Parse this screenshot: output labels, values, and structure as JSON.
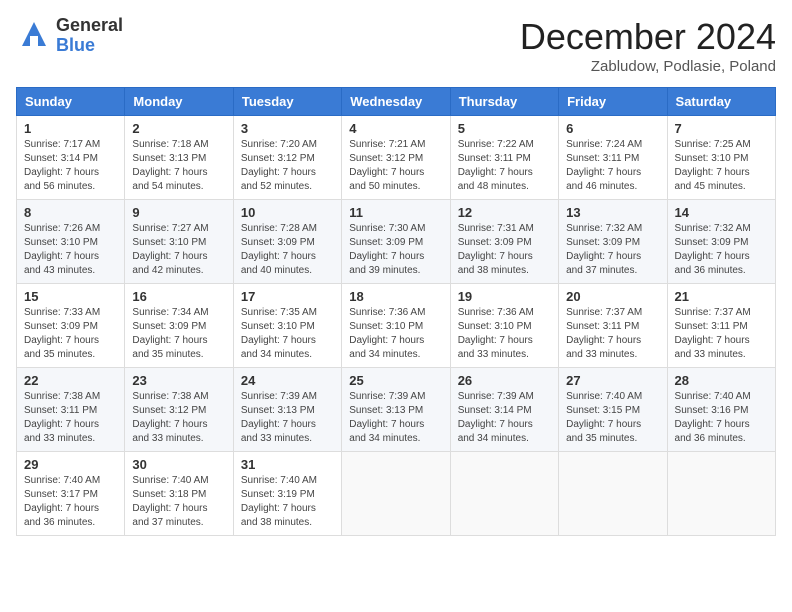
{
  "header": {
    "logo_general": "General",
    "logo_blue": "Blue",
    "month_title": "December 2024",
    "location": "Zabludow, Podlasie, Poland"
  },
  "days_of_week": [
    "Sunday",
    "Monday",
    "Tuesday",
    "Wednesday",
    "Thursday",
    "Friday",
    "Saturday"
  ],
  "weeks": [
    [
      {
        "day": "1",
        "sunrise": "7:17 AM",
        "sunset": "3:14 PM",
        "daylight": "7 hours and 56 minutes."
      },
      {
        "day": "2",
        "sunrise": "7:18 AM",
        "sunset": "3:13 PM",
        "daylight": "7 hours and 54 minutes."
      },
      {
        "day": "3",
        "sunrise": "7:20 AM",
        "sunset": "3:12 PM",
        "daylight": "7 hours and 52 minutes."
      },
      {
        "day": "4",
        "sunrise": "7:21 AM",
        "sunset": "3:12 PM",
        "daylight": "7 hours and 50 minutes."
      },
      {
        "day": "5",
        "sunrise": "7:22 AM",
        "sunset": "3:11 PM",
        "daylight": "7 hours and 48 minutes."
      },
      {
        "day": "6",
        "sunrise": "7:24 AM",
        "sunset": "3:11 PM",
        "daylight": "7 hours and 46 minutes."
      },
      {
        "day": "7",
        "sunrise": "7:25 AM",
        "sunset": "3:10 PM",
        "daylight": "7 hours and 45 minutes."
      }
    ],
    [
      {
        "day": "8",
        "sunrise": "7:26 AM",
        "sunset": "3:10 PM",
        "daylight": "7 hours and 43 minutes."
      },
      {
        "day": "9",
        "sunrise": "7:27 AM",
        "sunset": "3:10 PM",
        "daylight": "7 hours and 42 minutes."
      },
      {
        "day": "10",
        "sunrise": "7:28 AM",
        "sunset": "3:09 PM",
        "daylight": "7 hours and 40 minutes."
      },
      {
        "day": "11",
        "sunrise": "7:30 AM",
        "sunset": "3:09 PM",
        "daylight": "7 hours and 39 minutes."
      },
      {
        "day": "12",
        "sunrise": "7:31 AM",
        "sunset": "3:09 PM",
        "daylight": "7 hours and 38 minutes."
      },
      {
        "day": "13",
        "sunrise": "7:32 AM",
        "sunset": "3:09 PM",
        "daylight": "7 hours and 37 minutes."
      },
      {
        "day": "14",
        "sunrise": "7:32 AM",
        "sunset": "3:09 PM",
        "daylight": "7 hours and 36 minutes."
      }
    ],
    [
      {
        "day": "15",
        "sunrise": "7:33 AM",
        "sunset": "3:09 PM",
        "daylight": "7 hours and 35 minutes."
      },
      {
        "day": "16",
        "sunrise": "7:34 AM",
        "sunset": "3:09 PM",
        "daylight": "7 hours and 35 minutes."
      },
      {
        "day": "17",
        "sunrise": "7:35 AM",
        "sunset": "3:10 PM",
        "daylight": "7 hours and 34 minutes."
      },
      {
        "day": "18",
        "sunrise": "7:36 AM",
        "sunset": "3:10 PM",
        "daylight": "7 hours and 34 minutes."
      },
      {
        "day": "19",
        "sunrise": "7:36 AM",
        "sunset": "3:10 PM",
        "daylight": "7 hours and 33 minutes."
      },
      {
        "day": "20",
        "sunrise": "7:37 AM",
        "sunset": "3:11 PM",
        "daylight": "7 hours and 33 minutes."
      },
      {
        "day": "21",
        "sunrise": "7:37 AM",
        "sunset": "3:11 PM",
        "daylight": "7 hours and 33 minutes."
      }
    ],
    [
      {
        "day": "22",
        "sunrise": "7:38 AM",
        "sunset": "3:11 PM",
        "daylight": "7 hours and 33 minutes."
      },
      {
        "day": "23",
        "sunrise": "7:38 AM",
        "sunset": "3:12 PM",
        "daylight": "7 hours and 33 minutes."
      },
      {
        "day": "24",
        "sunrise": "7:39 AM",
        "sunset": "3:13 PM",
        "daylight": "7 hours and 33 minutes."
      },
      {
        "day": "25",
        "sunrise": "7:39 AM",
        "sunset": "3:13 PM",
        "daylight": "7 hours and 34 minutes."
      },
      {
        "day": "26",
        "sunrise": "7:39 AM",
        "sunset": "3:14 PM",
        "daylight": "7 hours and 34 minutes."
      },
      {
        "day": "27",
        "sunrise": "7:40 AM",
        "sunset": "3:15 PM",
        "daylight": "7 hours and 35 minutes."
      },
      {
        "day": "28",
        "sunrise": "7:40 AM",
        "sunset": "3:16 PM",
        "daylight": "7 hours and 36 minutes."
      }
    ],
    [
      {
        "day": "29",
        "sunrise": "7:40 AM",
        "sunset": "3:17 PM",
        "daylight": "7 hours and 36 minutes."
      },
      {
        "day": "30",
        "sunrise": "7:40 AM",
        "sunset": "3:18 PM",
        "daylight": "7 hours and 37 minutes."
      },
      {
        "day": "31",
        "sunrise": "7:40 AM",
        "sunset": "3:19 PM",
        "daylight": "7 hours and 38 minutes."
      },
      null,
      null,
      null,
      null
    ]
  ],
  "labels": {
    "sunrise": "Sunrise:",
    "sunset": "Sunset:",
    "daylight": "Daylight:"
  }
}
